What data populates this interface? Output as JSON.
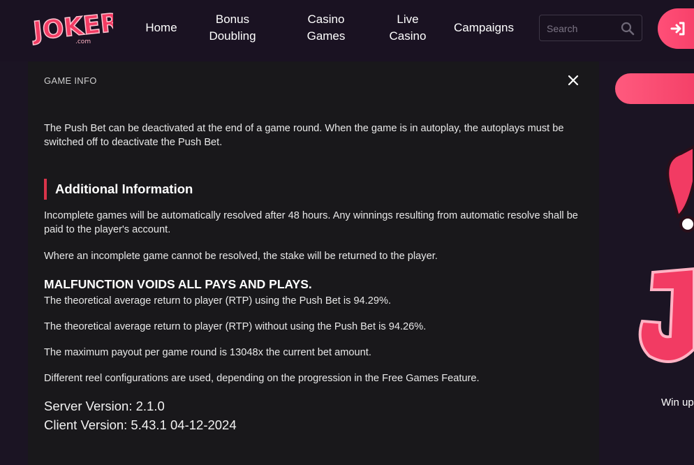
{
  "header": {
    "logo_text": "JOKERI",
    "logo_sub": ".com",
    "nav": [
      {
        "label": "Home"
      },
      {
        "label": "Bonus\nDoubling"
      },
      {
        "label": "Casino\nGames"
      },
      {
        "label": "Live\nCasino"
      },
      {
        "label": "Campaigns"
      }
    ],
    "search_placeholder": "Search"
  },
  "modal": {
    "title": "GAME INFO",
    "intro": "The Push Bet can be deactivated at the end of a game round. When the game is in autoplay, the autoplays must be switched off to deactivate the Push Bet.",
    "section_heading": "Additional Information",
    "paragraphs": [
      "Incomplete games will be automatically resolved after 48 hours. Any winnings resulting from automatic resolve shall be paid to the player's account.",
      "Where an incomplete game cannot be resolved, the stake will be returned to the player."
    ],
    "malfunction": "MALFUNCTION VOIDS ALL PAYS AND PLAYS.",
    "rtp_with": "The theoretical average return to player (RTP) using the Push Bet is 94.29%.",
    "rtp_without": "The theoretical average return to player (RTP) without using the Push Bet is 94.26%.",
    "max_payout": "The maximum payout per game round is 13048x the current bet amount.",
    "reels": "Different reel configurations are used, depending on the progression in the Free Games Feature.",
    "server_version": "Server Version: 2.1.0",
    "client_version": "Client Version: 5.43.1 04-12-2024"
  },
  "sidebar": {
    "promo_text": "Win up"
  },
  "colors": {
    "accent": "#f23b63",
    "modal_bg": "#19181b",
    "page_bg": "#1b1423",
    "heading_bar": "#d8344a"
  }
}
